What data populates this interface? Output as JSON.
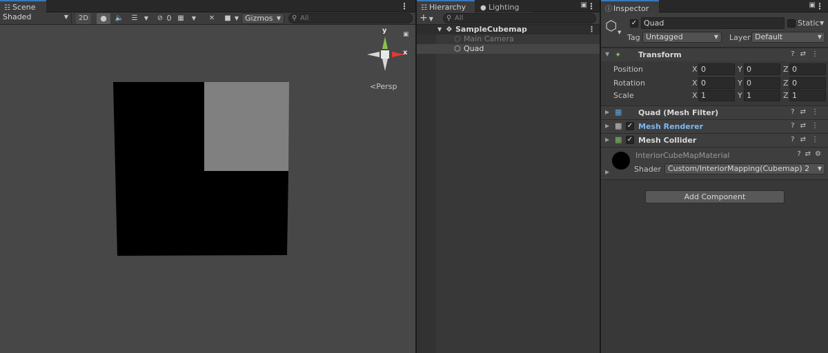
{
  "scene": {
    "tab_label": "Scene",
    "shading_mode": "Shaded",
    "btn_2d": "2D",
    "hidden_count": "0",
    "gizmos_label": "Gizmos",
    "search_placeholder": "All",
    "persp_label": "Persp",
    "axis_y": "y",
    "axis_x": "x"
  },
  "hierarchy": {
    "tab_label": "Hierarchy",
    "lighting_tab_label": "Lighting",
    "add_label": "+",
    "search_placeholder": "All",
    "scene_name": "SampleCubemap",
    "items": [
      {
        "label": "Main Camera",
        "disabled": true
      },
      {
        "label": "Quad",
        "disabled": false
      }
    ]
  },
  "inspector": {
    "tab_label": "Inspector",
    "object_name": "Quad",
    "static_label": "Static",
    "tag_label": "Tag",
    "tag_value": "Untagged",
    "layer_label": "Layer",
    "layer_value": "Default",
    "transform": {
      "title": "Transform",
      "rows": [
        {
          "label": "Position",
          "x": "0",
          "y": "0",
          "z": "0"
        },
        {
          "label": "Rotation",
          "x": "0",
          "y": "0",
          "z": "0"
        },
        {
          "label": "Scale",
          "x": "1",
          "y": "1",
          "z": "1"
        }
      ],
      "axis_x": "X",
      "axis_y": "Y",
      "axis_z": "Z"
    },
    "components": [
      {
        "name": "Quad (Mesh Filter)",
        "has_checkbox": false
      },
      {
        "name": "Mesh Renderer",
        "has_checkbox": true
      },
      {
        "name": "Mesh Collider",
        "has_checkbox": true
      }
    ],
    "material": {
      "name": "InteriorCubeMapMaterial",
      "shader_label": "Shader",
      "shader_value": "Custom/InteriorMapping(Cubemap) 2"
    },
    "add_component_label": "Add Component"
  },
  "colors": {
    "accent": "#3a79bb",
    "link_blue": "#7db7f0",
    "quad_gray": "#808080",
    "quad_black": "#000000",
    "scene_bg": "#474747"
  },
  "icons": [
    "hamburger-icon",
    "lightbulb-icon",
    "speaker-icon",
    "layers-icon",
    "eye-hidden-icon",
    "grid-icon",
    "tools-icon",
    "camera-icon",
    "search-icon",
    "lock-icon",
    "cube-icon",
    "help-icon",
    "preset-icon",
    "settings-icon",
    "unity-logo-icon"
  ]
}
